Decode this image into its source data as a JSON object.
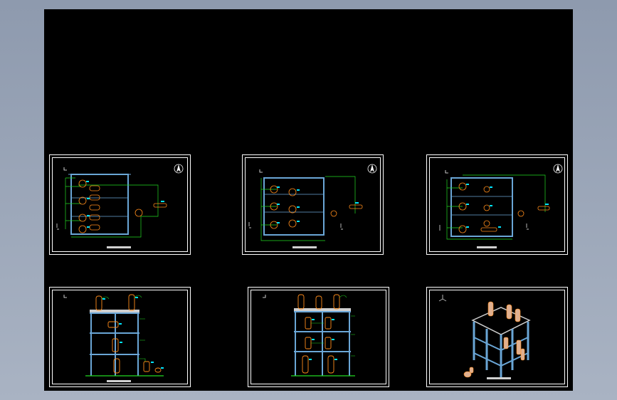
{
  "viewer": {
    "background_color": "#000000",
    "line_colors": {
      "frame": "#ffffff",
      "structure": "#6aa6d6",
      "pipe": "#22d922",
      "vessel": "#ff8c1a",
      "tag": "#00e5ff",
      "label": "#ffffff"
    }
  },
  "sheets": [
    {
      "id": "plan-1",
      "kind": "plan",
      "title": "",
      "icons": [
        "north-arrow-icon",
        "section-mark-icon"
      ]
    },
    {
      "id": "plan-2",
      "kind": "plan",
      "title": "",
      "icons": [
        "north-arrow-icon",
        "section-mark-icon"
      ]
    },
    {
      "id": "plan-3",
      "kind": "plan",
      "title": "",
      "icons": [
        "north-arrow-icon",
        "section-mark-icon"
      ]
    },
    {
      "id": "elevation-1",
      "kind": "elevation",
      "title": "",
      "icons": [
        "section-mark-icon"
      ]
    },
    {
      "id": "elevation-2",
      "kind": "elevation",
      "title": "",
      "icons": [
        "section-mark-icon"
      ]
    },
    {
      "id": "isometric",
      "kind": "isometric",
      "title": "",
      "icons": [
        "axis-mark-icon"
      ]
    }
  ]
}
